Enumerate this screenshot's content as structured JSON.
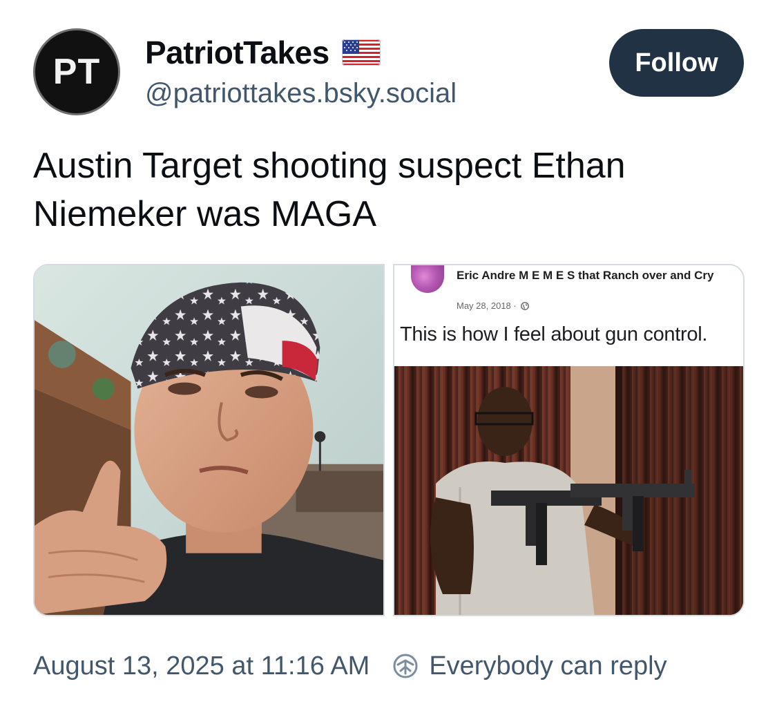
{
  "author": {
    "avatar_text": "PT",
    "display_name": "PatriotTakes",
    "flag_icon": "us-flag-emoji",
    "handle": "@patriottakes.bsky.social"
  },
  "follow_label": "Follow",
  "post": {
    "text": "Austin Target shooting suspect Ethan Niemeker was MAGA"
  },
  "images": {
    "right": {
      "page_name": "Eric  Andre M E M E S that Ranch over and Cry",
      "date": "May 28, 2018 · ",
      "caption": "This is how I feel about gun control."
    }
  },
  "footer": {
    "timestamp": "August 13, 2025 at 11:16 AM",
    "reply_icon": "reply-setting-icon",
    "reply_setting": "Everybody can reply"
  },
  "colors": {
    "follow_bg": "#213244",
    "secondary_text": "#42576c",
    "primary_text": "#0b0f14"
  }
}
